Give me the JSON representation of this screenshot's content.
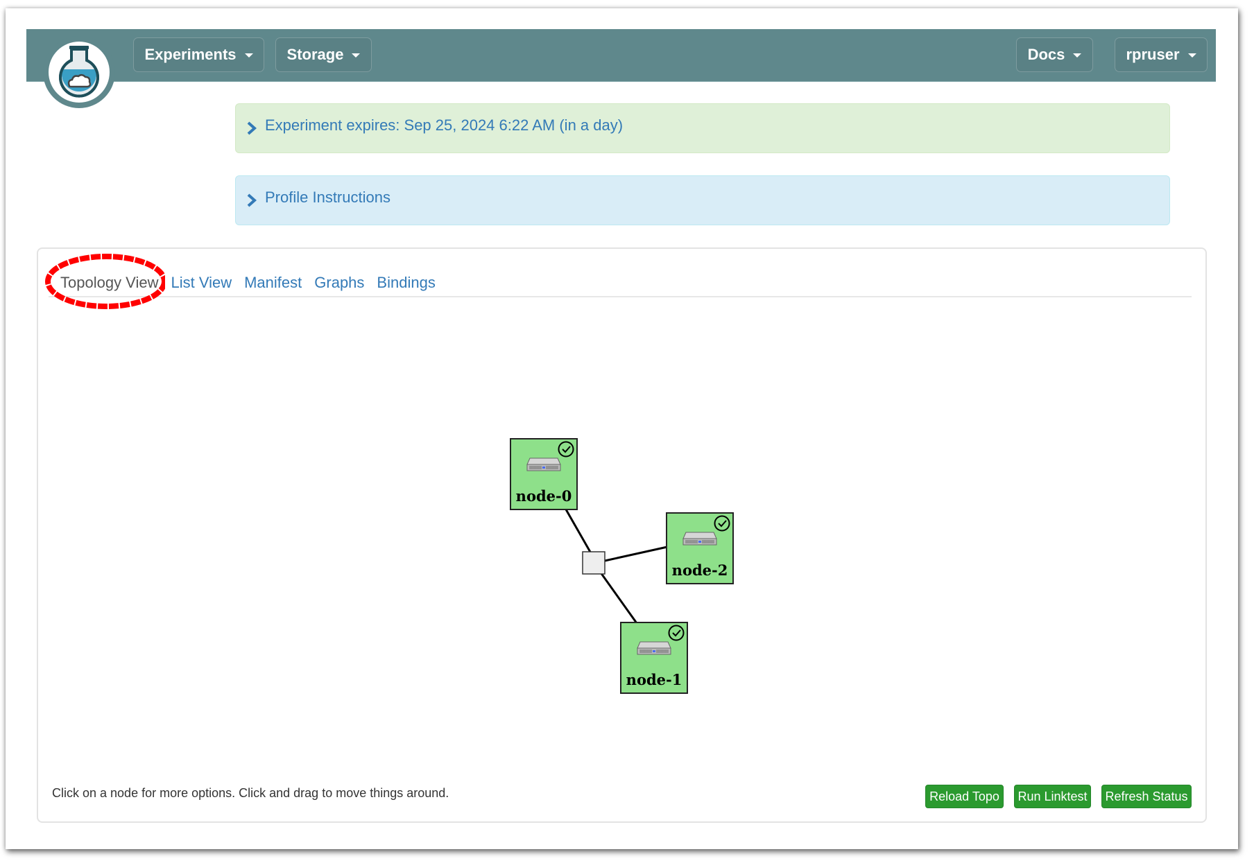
{
  "navbar": {
    "logo_alt": "flask-cloud-logo",
    "menus": [
      {
        "label": "Experiments"
      },
      {
        "label": "Storage"
      },
      {
        "label": "Docs"
      },
      {
        "label": "rpruser"
      }
    ]
  },
  "alerts": {
    "expiry": "Experiment expires: Sep 25, 2024 6:22 AM (in a day)",
    "instructions": "Profile Instructions"
  },
  "tabs": [
    {
      "label": "Topology View",
      "active": true
    },
    {
      "label": "List View",
      "active": false
    },
    {
      "label": "Manifest",
      "active": false
    },
    {
      "label": "Graphs",
      "active": false
    },
    {
      "label": "Bindings",
      "active": false
    }
  ],
  "topology": {
    "nodes": [
      {
        "name": "node-0",
        "status": "ready"
      },
      {
        "name": "node-2",
        "status": "ready"
      },
      {
        "name": "node-1",
        "status": "ready"
      }
    ],
    "lan": "lan-switch",
    "links": [
      [
        "node-0",
        "lan"
      ],
      [
        "node-2",
        "lan"
      ],
      [
        "node-1",
        "lan"
      ]
    ],
    "colors": {
      "node_fill": "#8ee08a",
      "lan_fill": "#eeeeee",
      "status_ok": "#000000"
    }
  },
  "footer": {
    "hint": "Click on a node for more options. Click and drag to move things around.",
    "buttons": {
      "reload": "Reload Topo",
      "linktest": "Run Linktest",
      "refresh": "Refresh Status"
    }
  },
  "colors": {
    "navbar": "#5f888c",
    "link": "#337ab7",
    "button_green": "#2b9a2f",
    "annotation": "#ff0000"
  }
}
